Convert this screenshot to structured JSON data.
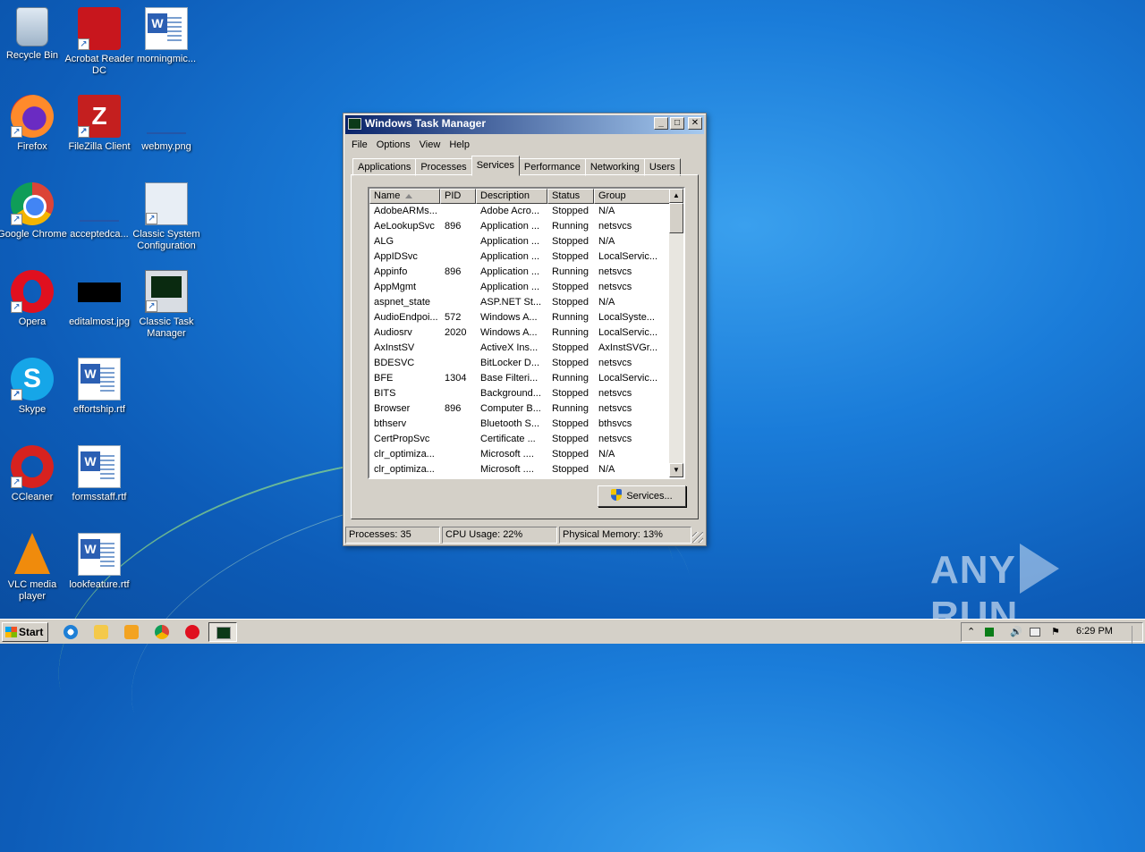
{
  "desktop": {
    "icons": [
      {
        "label": "Recycle Bin"
      },
      {
        "label": "Acrobat Reader DC"
      },
      {
        "label": "morningmic..."
      },
      {
        "label": "Firefox"
      },
      {
        "label": "FileZilla Client"
      },
      {
        "label": "webmy.png"
      },
      {
        "label": "Google Chrome"
      },
      {
        "label": "acceptedca..."
      },
      {
        "label": "Classic System Configuration"
      },
      {
        "label": "Opera"
      },
      {
        "label": "editalmost.jpg"
      },
      {
        "label": "Classic Task Manager"
      },
      {
        "label": "Skype"
      },
      {
        "label": "effortship.rtf"
      },
      {
        "label": "CCleaner"
      },
      {
        "label": "formsstaff.rtf"
      },
      {
        "label": "VLC media player"
      },
      {
        "label": "lookfeature.rtf"
      }
    ]
  },
  "window": {
    "title": "Windows Task Manager",
    "controls": {
      "minimize": "_",
      "maximize": "□",
      "close": "✕"
    },
    "menu": [
      "File",
      "Options",
      "View",
      "Help"
    ],
    "tabs": [
      "Applications",
      "Processes",
      "Services",
      "Performance",
      "Networking",
      "Users"
    ],
    "active_tab": "Services",
    "columns": [
      "Name",
      "PID",
      "Description",
      "Status",
      "Group"
    ],
    "rows": [
      [
        "AdobeARMs...",
        "",
        "Adobe Acro...",
        "Stopped",
        "N/A"
      ],
      [
        "AeLookupSvc",
        "896",
        "Application ...",
        "Running",
        "netsvcs"
      ],
      [
        "ALG",
        "",
        "Application ...",
        "Stopped",
        "N/A"
      ],
      [
        "AppIDSvc",
        "",
        "Application ...",
        "Stopped",
        "LocalServic..."
      ],
      [
        "Appinfo",
        "896",
        "Application ...",
        "Running",
        "netsvcs"
      ],
      [
        "AppMgmt",
        "",
        "Application ...",
        "Stopped",
        "netsvcs"
      ],
      [
        "aspnet_state",
        "",
        "ASP.NET St...",
        "Stopped",
        "N/A"
      ],
      [
        "AudioEndpoi...",
        "572",
        "Windows A...",
        "Running",
        "LocalSyste..."
      ],
      [
        "Audiosrv",
        "2020",
        "Windows A...",
        "Running",
        "LocalServic..."
      ],
      [
        "AxInstSV",
        "",
        "ActiveX Ins...",
        "Stopped",
        "AxInstSVGr..."
      ],
      [
        "BDESVC",
        "",
        "BitLocker D...",
        "Stopped",
        "netsvcs"
      ],
      [
        "BFE",
        "1304",
        "Base Filteri...",
        "Running",
        "LocalServic..."
      ],
      [
        "BITS",
        "",
        "Background...",
        "Stopped",
        "netsvcs"
      ],
      [
        "Browser",
        "896",
        "Computer B...",
        "Running",
        "netsvcs"
      ],
      [
        "bthserv",
        "",
        "Bluetooth S...",
        "Stopped",
        "bthsvcs"
      ],
      [
        "CertPropSvc",
        "",
        "Certificate ...",
        "Stopped",
        "netsvcs"
      ],
      [
        "clr_optimiza...",
        "",
        "Microsoft ....",
        "Stopped",
        "N/A"
      ],
      [
        "clr_optimiza...",
        "",
        "Microsoft ....",
        "Stopped",
        "N/A"
      ]
    ],
    "services_button": "Services...",
    "status": {
      "processes": "Processes: 35",
      "cpu": "CPU Usage: 22%",
      "memory": "Physical Memory: 13%"
    }
  },
  "watermark": {
    "left": "ANY",
    "right": "RUN"
  },
  "taskbar": {
    "start_label": "Start",
    "quick_launch": [
      "ie-icon",
      "explorer-icon",
      "media-player-icon",
      "chrome-icon",
      "opera-icon"
    ],
    "clock": "6:29 PM",
    "tray_up": "⌃",
    "tray_volume": "🔊",
    "tray_flag": "⚑"
  }
}
